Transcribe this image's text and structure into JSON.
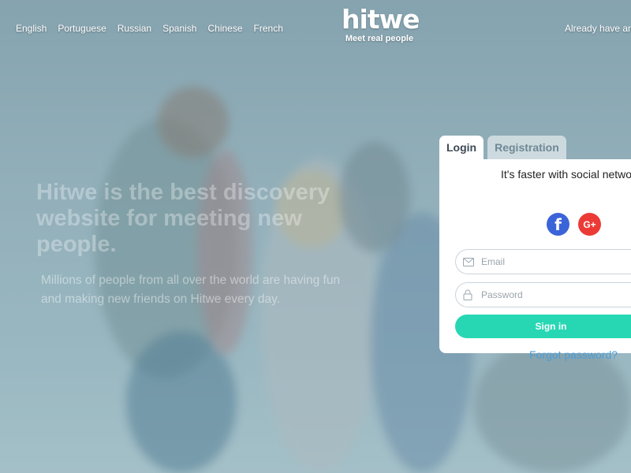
{
  "header": {
    "languages": [
      "English",
      "Portuguese",
      "Russian",
      "Spanish",
      "Chinese",
      "French"
    ],
    "logo": {
      "text": "hitwe",
      "tagline": "Meet real people"
    },
    "account_link": "Already have an"
  },
  "hero": {
    "title": "Hitwe is the best discovery website for meeting new people.",
    "subtitle": "Millions of people from all over the world are having fun and making new friends on Hitwe every day."
  },
  "auth": {
    "tabs": {
      "login": "Login",
      "registration": "Registration"
    },
    "social_title": "It's faster with social netwo",
    "social": {
      "facebook_icon": "facebook-icon",
      "google_icon": "google-plus-icon"
    },
    "email_placeholder": "Email",
    "password_placeholder": "Password",
    "signin_label": "Sign in",
    "forgot_label": "Forgot password?"
  },
  "colors": {
    "accent": "#27d7b4",
    "facebook": "#3b64d8",
    "google": "#ec3b36",
    "link": "#4a9ed8"
  }
}
